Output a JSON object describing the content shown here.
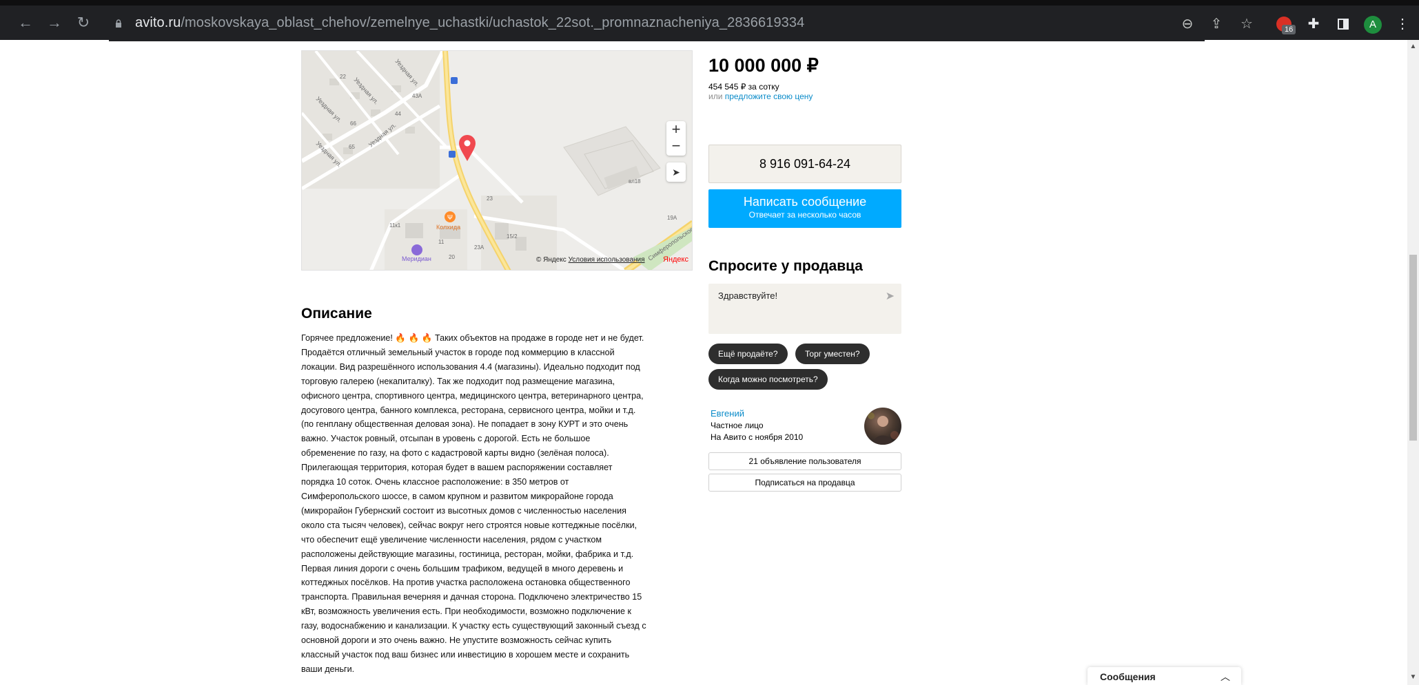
{
  "browser": {
    "url_host": "avito.ru",
    "url_path": "/moskovskaya_oblast_chehov/zemelnye_uchastki/uchastok_22sot._promnaznacheniya_2836619334",
    "extension_badge": "16",
    "profile_initial": "A"
  },
  "map": {
    "zoom_in": "+",
    "zoom_out": "−",
    "copyright": "© Яндекс",
    "terms_link": "Условия использования",
    "logo": "Яндекс",
    "labels": {
      "street1": "Уездная ул.",
      "street2": "Уездная ул.",
      "street3": "Уездная ул.",
      "street4": "Уездная ул.",
      "street5": "Уездная ул.",
      "poi1": "Колхида",
      "poi2": "Меридиан",
      "road": "Симферопольское ш.",
      "house_22": "22",
      "house_43a": "43А",
      "house_44": "44",
      "house_66": "66",
      "house_65": "65",
      "house_23": "23",
      "house_11k1": "11к1",
      "house_11": "11",
      "house_23a": "23А",
      "house_15_2": "15/2",
      "house_19a": "19А",
      "house_20": "20",
      "house_vl18": "вл18"
    }
  },
  "listing": {
    "price": "10 000 000 ₽",
    "price_per_unit": "454 545 ₽ за сотку",
    "offer_prefix": "или ",
    "offer_link": "предложите свою цену"
  },
  "contact": {
    "phone": "8 916 091-64-24",
    "message_button": "Написать сообщение",
    "message_subtitle": "Отвечает за несколько часов"
  },
  "ask": {
    "title": "Спросите у продавца",
    "input_value": "Здравствуйте!",
    "chips": [
      "Ещё продаёте?",
      "Торг уместен?",
      "Когда можно посмотреть?"
    ]
  },
  "seller": {
    "name": "Евгений",
    "type": "Частное лицо",
    "since": "На Авито с ноября 2010",
    "listings_button": "21 объявление пользователя",
    "subscribe_button": "Подписаться на продавца"
  },
  "description": {
    "title": "Описание",
    "lines": [
      "Горячее предложение! 🔥 🔥 🔥 Таких объектов на продаже в городе нет и не будет.",
      "Продаётся отличный земельный участок в городе под коммерцию в классной",
      "локации. Вид разрешённого использования 4.4 (магазины). Идеально подходит под",
      "торговую галерею (некапиталку). Так же подходит под размещение магазина,",
      "офисного центра, спортивного центра, медицинского центра, ветеринарного центра,",
      "досугового центра, банного комплекса, ресторана, сервисного центра, мойки и т.д.",
      "(по генплану общественная деловая зона). Не попадает в зону КУРТ и это очень",
      "важно. Участок ровный, отсыпан в уровень с дорогой. Есть не большое",
      "обременение по газу, на фото с кадастровой карты видно (зелёная полоса).",
      "Прилегающая территория, которая будет в вашем распоряжении составляет",
      "порядка 10 соток. Очень классное расположение: в 350 метров от",
      "Симферопольского шоссе, в самом крупном и развитом микрорайоне города",
      "(микрорайон Губернский состоит из высотных домов с численностью населения",
      "около ста тысяч человек), сейчас вокруг него строятся новые коттеджные посёлки,",
      "что обеспечит ещё увеличение численности населения, рядом с участком",
      "расположены действующие магазины, гостиница, ресторан, мойки, фабрика и т.д.",
      "Первая линия дороги с очень большим трафиком, ведущей в много деревень и",
      "коттеджных посёлков. На против участка расположена остановка общественного",
      "транспорта. Правильная вечерняя и дачная сторона. Подключено электричество 15",
      "кВт, возможность увеличения есть. При необходимости, возможно подключение к",
      "газу, водоснабжению и канализации. К участку есть существующий законный съезд с",
      "основной дороги и это очень важно. Не упустите возможность сейчас купить",
      "классный участок под ваш бизнес или инвестицию в хорошем месте и сохранить",
      "ваши деньги."
    ]
  },
  "messenger": {
    "label": "Сообщения"
  }
}
